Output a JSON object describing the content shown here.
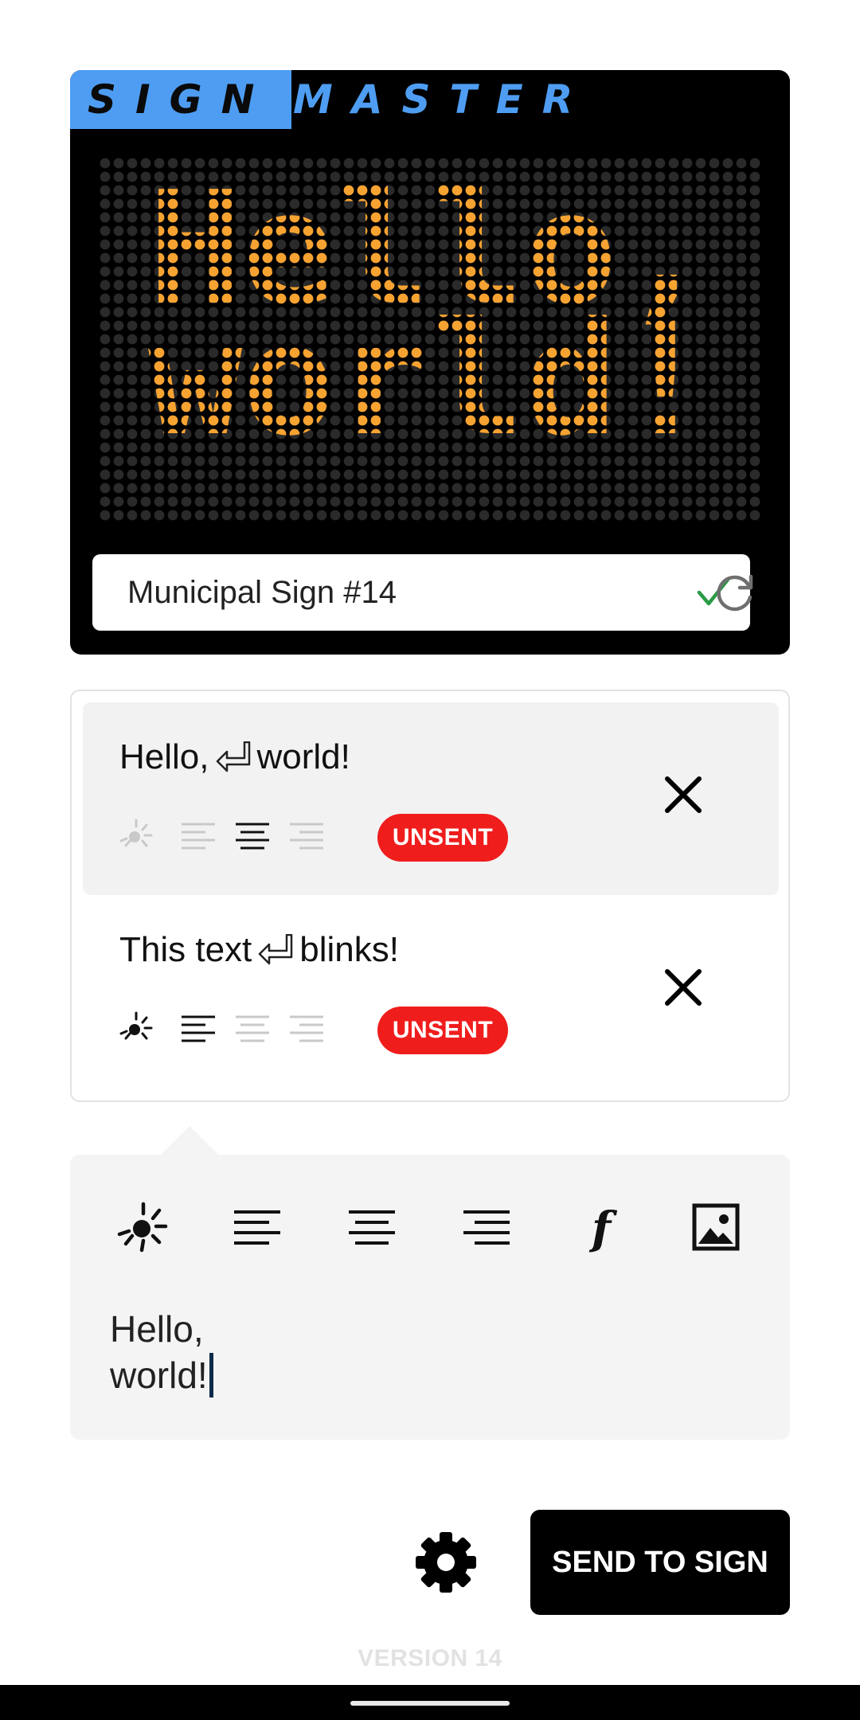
{
  "app": {
    "logo_left": "SIGN",
    "logo_right": "MASTER",
    "colors": {
      "brand_blue": "#4e9df2",
      "led_on": "#f6a332",
      "led_off": "#2a2a2a",
      "unsent_red": "#f01d1d",
      "check_green": "#2a9a45"
    }
  },
  "display": {
    "lines": [
      "Hello,",
      "world!"
    ],
    "sign_name": "Municipal Sign #14",
    "status_icon": "check-icon",
    "refresh_icon": "refresh-icon"
  },
  "messages": [
    {
      "text_before": "Hello,",
      "text_after": "world!",
      "line_break_icon": "return-arrow-icon",
      "blink": false,
      "align": "center",
      "status": "UNSENT",
      "selected": true
    },
    {
      "text_before": "This text",
      "text_after": "blinks!",
      "line_break_icon": "return-arrow-icon",
      "blink": true,
      "align": "left",
      "status": "UNSENT",
      "selected": false
    }
  ],
  "editor": {
    "tools": [
      "blink-icon",
      "align-left-icon",
      "align-center-icon",
      "align-right-icon",
      "font-icon",
      "image-icon"
    ],
    "text": "Hello,\nworld!"
  },
  "actions": {
    "settings_icon": "gear-icon",
    "send_label": "SEND TO SIGN"
  },
  "footer": {
    "version": "VERSION 14"
  }
}
